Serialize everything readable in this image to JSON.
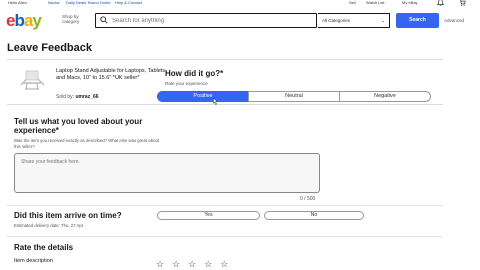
{
  "topbar": {
    "greeting": "Hello Allen",
    "links": [
      "Nectar",
      "Daily Deals",
      "Brand Outlet",
      "Help & Contact"
    ],
    "right": [
      "Sell",
      "Watch List",
      "My eBay"
    ]
  },
  "header": {
    "logo": {
      "e": "e",
      "b": "b",
      "a": "a",
      "y": "y"
    },
    "shop_by": "Shop by category",
    "search_placeholder": "Search for anything",
    "category": "All Categories",
    "search_button": "Search",
    "advanced": "Advanced"
  },
  "page": {
    "title": "Leave Feedback"
  },
  "item": {
    "title": "Laptop Stand Adjustable for Laptops, Tablets and Macs, 10\" to 15.6\" *UK seller*",
    "seller_label": "Sold by:",
    "seller_name": "umraz_66"
  },
  "rating": {
    "question": "How did it go?*",
    "subtext": "Rate your experience",
    "options": [
      "Positive",
      "Neutral",
      "Negative"
    ],
    "selected": "Positive"
  },
  "loved": {
    "question": "Tell us what you loved about your experience*",
    "subtext": "Was the item you received exactly as described? What else was great about this seller?",
    "placeholder": "Share your feedback here.",
    "counter": "0 / 500"
  },
  "arrive": {
    "question": "Did this item arrive on time?",
    "subtext": "Estimated delivery date: Thu, 27 Apr",
    "yes": "Yes",
    "no": "No"
  },
  "details": {
    "heading": "Rate the details",
    "item_description": "Item description",
    "stars": "☆☆☆☆☆"
  }
}
